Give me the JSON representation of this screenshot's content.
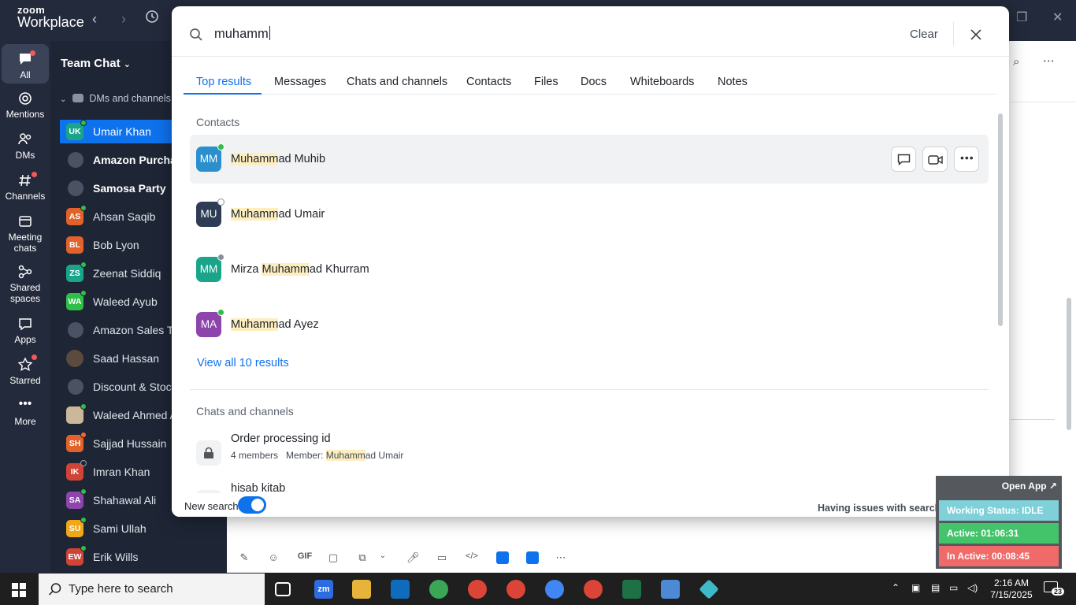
{
  "app": {
    "logo_line1": "zoom",
    "logo_line2": "Workplace"
  },
  "rail": {
    "items": [
      {
        "label": "All"
      },
      {
        "label": "Mentions"
      },
      {
        "label": "DMs"
      },
      {
        "label": "Channels"
      },
      {
        "label": "Meeting chats"
      },
      {
        "label": "Shared spaces"
      },
      {
        "label": "Apps"
      },
      {
        "label": "Starred"
      },
      {
        "label": "More"
      }
    ]
  },
  "sidebar": {
    "title": "Team Chat",
    "section": "DMs and channels",
    "items": [
      {
        "initials": "UK",
        "label": "Umair Khan",
        "color": "#1aa58a"
      },
      {
        "initials": "",
        "label": "Amazon Purchas",
        "color": ""
      },
      {
        "initials": "",
        "label": "Samosa Party",
        "color": ""
      },
      {
        "initials": "AS",
        "label": "Ahsan Saqib",
        "color": "#e2622b"
      },
      {
        "initials": "BL",
        "label": "Bob Lyon",
        "color": "#e2622b"
      },
      {
        "initials": "ZS",
        "label": "Zeenat Siddiq",
        "color": "#1aa58a"
      },
      {
        "initials": "WA",
        "label": "Waleed Ayub",
        "color": "#2fbf49"
      },
      {
        "initials": "",
        "label": "Amazon Sales Te",
        "color": ""
      },
      {
        "initials": "",
        "label": "Saad Hassan",
        "color": ""
      },
      {
        "initials": "",
        "label": "Discount & Stock",
        "color": ""
      },
      {
        "initials": "",
        "label": "Waleed Ahmed A",
        "color": ""
      },
      {
        "initials": "SH",
        "label": "Sajjad Hussain",
        "color": "#e2622b"
      },
      {
        "initials": "IK",
        "label": "Imran Khan",
        "color": "#d04437"
      },
      {
        "initials": "SA",
        "label": "Shahawal Ali",
        "color": "#8e44ad"
      },
      {
        "initials": "SU",
        "label": "Sami Ullah",
        "color": "#f0a818"
      },
      {
        "initials": "EW",
        "label": "Erik Wills",
        "color": "#d04437"
      }
    ]
  },
  "search": {
    "query": "muhamm",
    "clear_label": "Clear",
    "tabs": [
      "Top results",
      "Messages",
      "Chats and channels",
      "Contacts",
      "Files",
      "Docs",
      "Whiteboards",
      "Notes"
    ],
    "contacts_header": "Contacts",
    "contacts": [
      {
        "initials": "MM",
        "pre": "",
        "match": "Muhamm",
        "post": "ad Muhib",
        "av_color": "#2a8fcc",
        "status_color": "#2fbf49"
      },
      {
        "initials": "MU",
        "pre": "",
        "match": "Muhamm",
        "post": "ad Umair",
        "av_color": "#2e3d55",
        "status_color": "#ffffff"
      },
      {
        "initials": "MM",
        "pre": "Mirza ",
        "match": "Muhamm",
        "post": "ad Khurram",
        "av_color": "#1aa58a",
        "status_color": "#8a9099"
      },
      {
        "initials": "MA",
        "pre": "",
        "match": "Muhamm",
        "post": "ad Ayez",
        "av_color": "#8e44ad",
        "status_color": "#2fbf49"
      }
    ],
    "view_all": "View all 10 results",
    "channels_header": "Chats and channels",
    "channels": [
      {
        "name": "Order processing id",
        "members": "4 members",
        "member_pre": "Member: ",
        "member_match": "Muhamm",
        "member_post": "ad Umair"
      },
      {
        "name": "hisab kitab",
        "members": "",
        "member_pre": "",
        "member_match": "",
        "member_post": ""
      }
    ],
    "new_search_label": "New search",
    "issues_text": "Having issues with search?"
  },
  "widget": {
    "open_app": "Open App ↗",
    "working_status": "Working Status: IDLE",
    "active": "Active: 01:06:31",
    "inactive": "In Active: 00:08:45"
  },
  "taskbar": {
    "search_placeholder": "Type here to search",
    "time": "2:16 AM",
    "date": "7/15/2025",
    "notif_count": "23"
  },
  "colors": {
    "accent": "#0e72ed",
    "rail_bg": "#232a3b",
    "sidebar_bg": "#1e2535"
  }
}
